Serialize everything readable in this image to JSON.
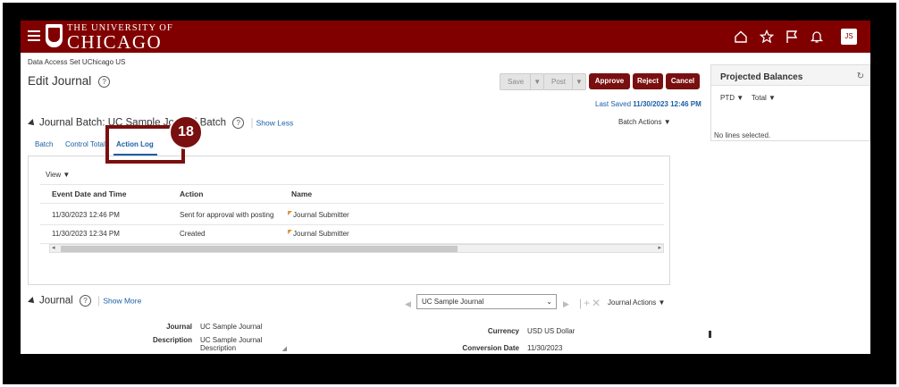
{
  "topbar": {
    "logo_small": "THE UNIVERSITY OF",
    "logo_big": "CHICAGO",
    "avatar_initials": "JS",
    "icons": [
      "home-icon",
      "star-icon",
      "flag-icon",
      "bell-icon"
    ],
    "brand_color": "#800000"
  },
  "data_access_set": "Data Access Set  UChicago US",
  "page_title": "Edit Journal",
  "toolbar": {
    "save_label": "Save",
    "post_label": "Post",
    "approve_label": "Approve",
    "reject_label": "Reject",
    "cancel_label": "Cancel"
  },
  "last_saved": {
    "label": "Last Saved",
    "value": "11/30/2023 12:46 PM"
  },
  "batch": {
    "header": "Journal Batch: UC Sample Journal Batch",
    "show_less": "Show Less",
    "batch_actions": "Batch Actions ▼",
    "tabs": [
      {
        "label": "Batch"
      },
      {
        "label": "Control Total"
      },
      {
        "label": "Action Log"
      }
    ]
  },
  "callout_number": "18",
  "action_log": {
    "view_menu": "View ▼",
    "columns": [
      "Event Date and Time",
      "Action",
      "Name"
    ],
    "rows": [
      [
        "11/30/2023 12:46 PM",
        "Sent for approval with posting",
        "Journal Submitter"
      ],
      [
        "11/30/2023 12:34 PM",
        "Created",
        "Journal Submitter"
      ]
    ]
  },
  "journal": {
    "header": "Journal",
    "show_more": "Show More",
    "selected_journal": "UC Sample Journal",
    "journal_actions": "Journal Actions ▼",
    "fields": {
      "journal_label": "Journal",
      "journal_value": "UC Sample Journal",
      "description_label": "Description",
      "description_value_1": "UC Sample Journal",
      "description_value_2": "Description",
      "currency_label": "Currency",
      "currency_value": "USD US Dollar",
      "conversion_date_label": "Conversion Date",
      "conversion_date_value": "11/30/2023"
    }
  },
  "projected_balances": {
    "title": "Projected Balances",
    "ptd": "PTD ▼",
    "total": "Total ▼",
    "no_lines": "No lines selected."
  }
}
